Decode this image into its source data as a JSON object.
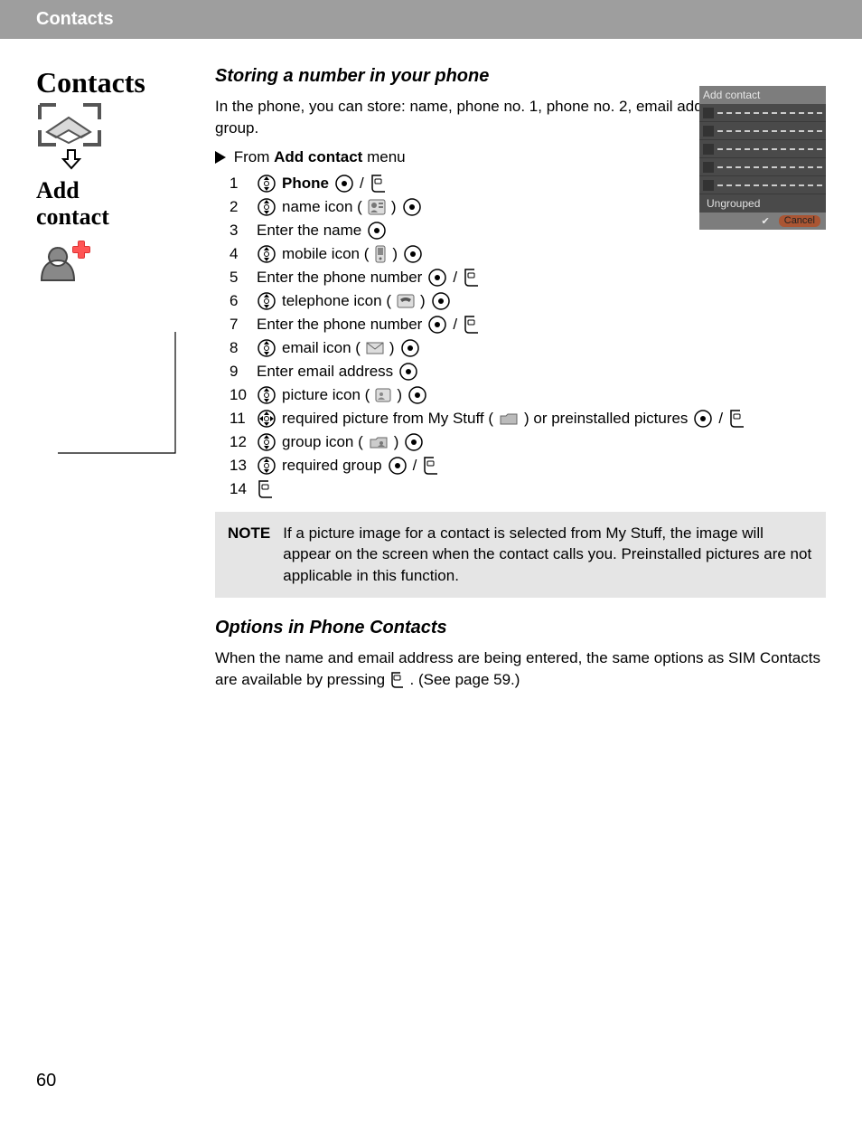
{
  "header": {
    "section": "Contacts"
  },
  "sidebar": {
    "title": "Contacts",
    "add_line1": "Add",
    "add_line2": "contact"
  },
  "main": {
    "heading1": "Storing a number in your phone",
    "intro": "In the phone, you can store: name, phone no. 1, phone no. 2, email address, picture and group.",
    "from_prefix": "From ",
    "from_bold": "Add contact",
    "from_suffix": " menu",
    "steps": {
      "s1_bold": "Phone",
      "s2_a": "name icon (",
      "s2_b": ")",
      "s3": "Enter the name",
      "s4_a": "mobile icon (",
      "s4_b": ")",
      "s5": "Enter the phone number",
      "s6_a": "telephone icon (",
      "s6_b": ")",
      "s7": "Enter the phone number",
      "s8_a": "email icon (",
      "s8_b": ")",
      "s9": "Enter email address",
      "s10_a": "picture icon (",
      "s10_b": ")",
      "s11_a": "required picture from My Stuff (",
      "s11_b": ") or preinstalled pictures",
      "s12_a": "group icon (",
      "s12_b": ")",
      "s13": "required group"
    },
    "note_label": "NOTE",
    "note_text": "If a picture image for a contact is selected from My Stuff, the image will appear on the screen when the contact calls you. Preinstalled pictures are not applicable in this function.",
    "heading2": "Options in Phone Contacts",
    "body2_a": "When the name and email address are being entered, the same options as SIM Contacts are available by pressing ",
    "body2_b": ". (See page 59.)"
  },
  "phone_screen": {
    "title": "Add contact",
    "ungrouped": "Ungrouped",
    "cancel": "Cancel"
  },
  "page_number": "60"
}
